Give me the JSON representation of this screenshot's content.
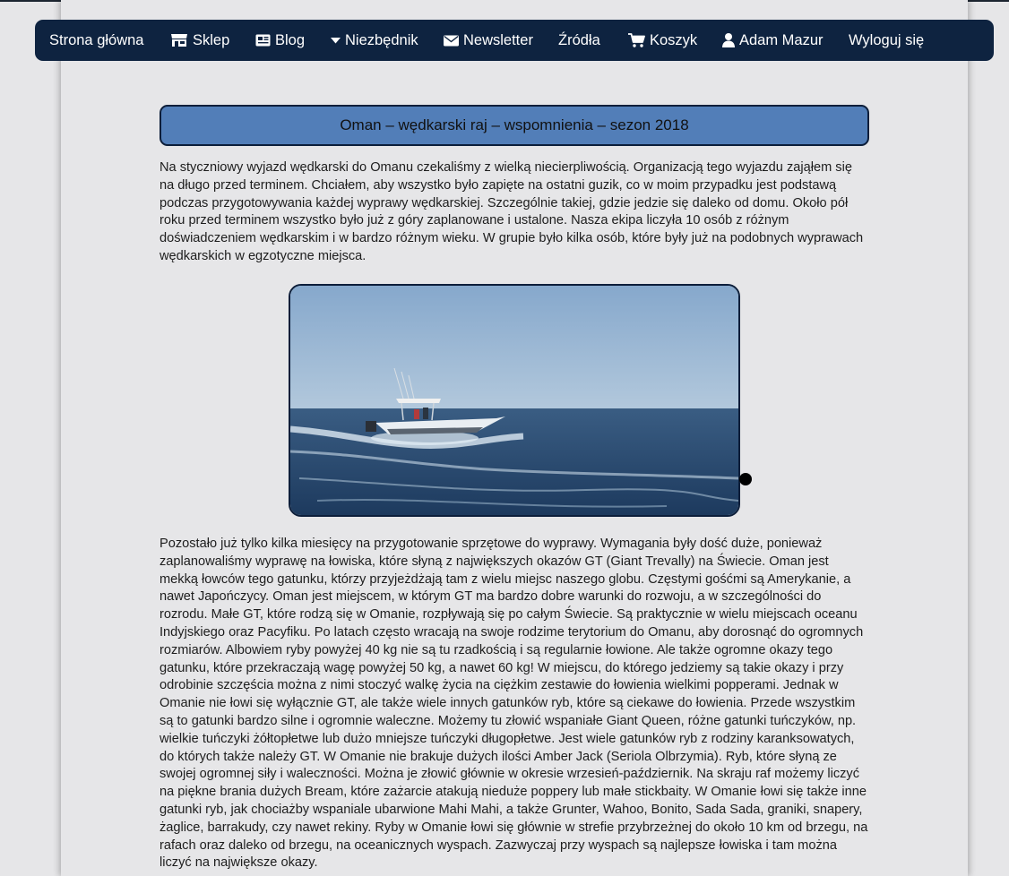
{
  "nav": {
    "items": [
      {
        "label": "Strona główna",
        "icon": ""
      },
      {
        "label": "Sklep",
        "icon": "shop-icon"
      },
      {
        "label": "Blog",
        "icon": "newspaper-icon"
      },
      {
        "label": "Niezbędnik",
        "icon": "caret-down-icon"
      },
      {
        "label": "Newsletter",
        "icon": "envelope-icon"
      },
      {
        "label": "Źródła",
        "icon": ""
      },
      {
        "label": "Koszyk",
        "icon": "cart-icon"
      },
      {
        "label": "Adam Mazur",
        "icon": "user-icon"
      },
      {
        "label": "Wyloguj się",
        "icon": ""
      }
    ]
  },
  "article": {
    "title": "Oman – wędkarski raj – wspomnienia – sezon 2018",
    "paragraph1": "Na styczniowy wyjazd wędkarski do Omanu czekaliśmy z wielką niecierpliwością. Organizacją tego wyjazdu zająłem się na długo przed terminem. Chciałem, aby wszystko było zapięte na ostatni guzik, co w moim przypadku jest podstawą podczas przygotowywania każdej wyprawy wędkarskiej. Szczególnie takiej, gdzie jedzie się daleko od domu. Około pół roku przed terminem wszystko było już z góry zaplanowane i ustalone. Nasza ekipa liczyła 10 osób z różnym doświadczeniem wędkarskim i w bardzo różnym wieku. W grupie było kilka osób, które były już na podobnych wyprawach wędkarskich w egzotyczne miejsca.",
    "paragraph2": "Pozostało już tylko kilka miesięcy na przygotowanie sprzętowe do wyprawy. Wymagania były dość duże, ponieważ zaplanowaliśmy wyprawę na łowiska, które słyną z największych okazów GT (Giant Trevally) na Świecie. Oman jest mekką łowców tego gatunku, którzy przyjeżdżają tam z wielu miejsc naszego globu. Częstymi gośćmi są Amerykanie, a nawet Japończycy. Oman jest miejscem, w którym GT ma bardzo dobre warunki do rozwoju, a w szczególności do rozrodu. Małe GT, które rodzą się w Omanie, rozpływają się po całym Świecie. Są praktycznie w wielu miejscach oceanu Indyjskiego oraz Pacyfiku. Po latach często wracają na swoje rodzime terytorium do Omanu, aby dorosnąć do ogromnych rozmiarów. Albowiem ryby powyżej 40 kg nie są tu rzadkością i są regularnie łowione. Ale także ogromne okazy tego gatunku, które przekraczają wagę powyżej 50 kg, a nawet 60 kg! W miejscu, do którego jedziemy są takie okazy i przy odrobinie szczęścia można z nimi stoczyć walkę życia na ciężkim zestawie do łowienia wielkimi popperami. Jednak w Omanie nie łowi się wyłącznie GT, ale także wiele innych gatunków ryb, które są ciekawe do łowienia. Przede wszystkim są to gatunki bardzo silne i ogromnie waleczne. Możemy tu złowić wspaniałe Giant Queen, różne gatunki tuńczyków, np. wielkie tuńczyki żółtopłetwe lub dużo mniejsze tuńczyki długopłetwe. Jest wiele gatunków ryb z rodziny karanksowatych, do których także należy GT. W Omanie nie brakuje dużych ilości Amber Jack (Seriola Olbrzymia). Ryb, które słyną ze swojej ogromnej siły i waleczności. Można je złowić głównie w okresie wrzesień-październik. Na skraju raf możemy liczyć na piękne brania dużych Bream, które zażarcie atakują nieduże poppery lub małe stickbaity. W Omanie łowi się także inne gatunki ryb, jak chociażby wspaniale ubarwione Mahi Mahi, a także Grunter, Wahoo, Bonito, Sada Sada, graniki, snapery, żaglice, barrakudy, czy nawet rekiny. Ryby w Omanie łowi się głównie w strefie przybrzeżnej do około 10 km od brzegu, na rafach oraz daleko od brzegu, na oceanicznych wyspach. Zazwyczaj przy wyspach są najlepsze łowiska i tam można liczyć na największe okazy."
  },
  "colors": {
    "navbar": "#0e2340",
    "title_box": "#527eb8",
    "page_bg": "#e6e6e8"
  }
}
